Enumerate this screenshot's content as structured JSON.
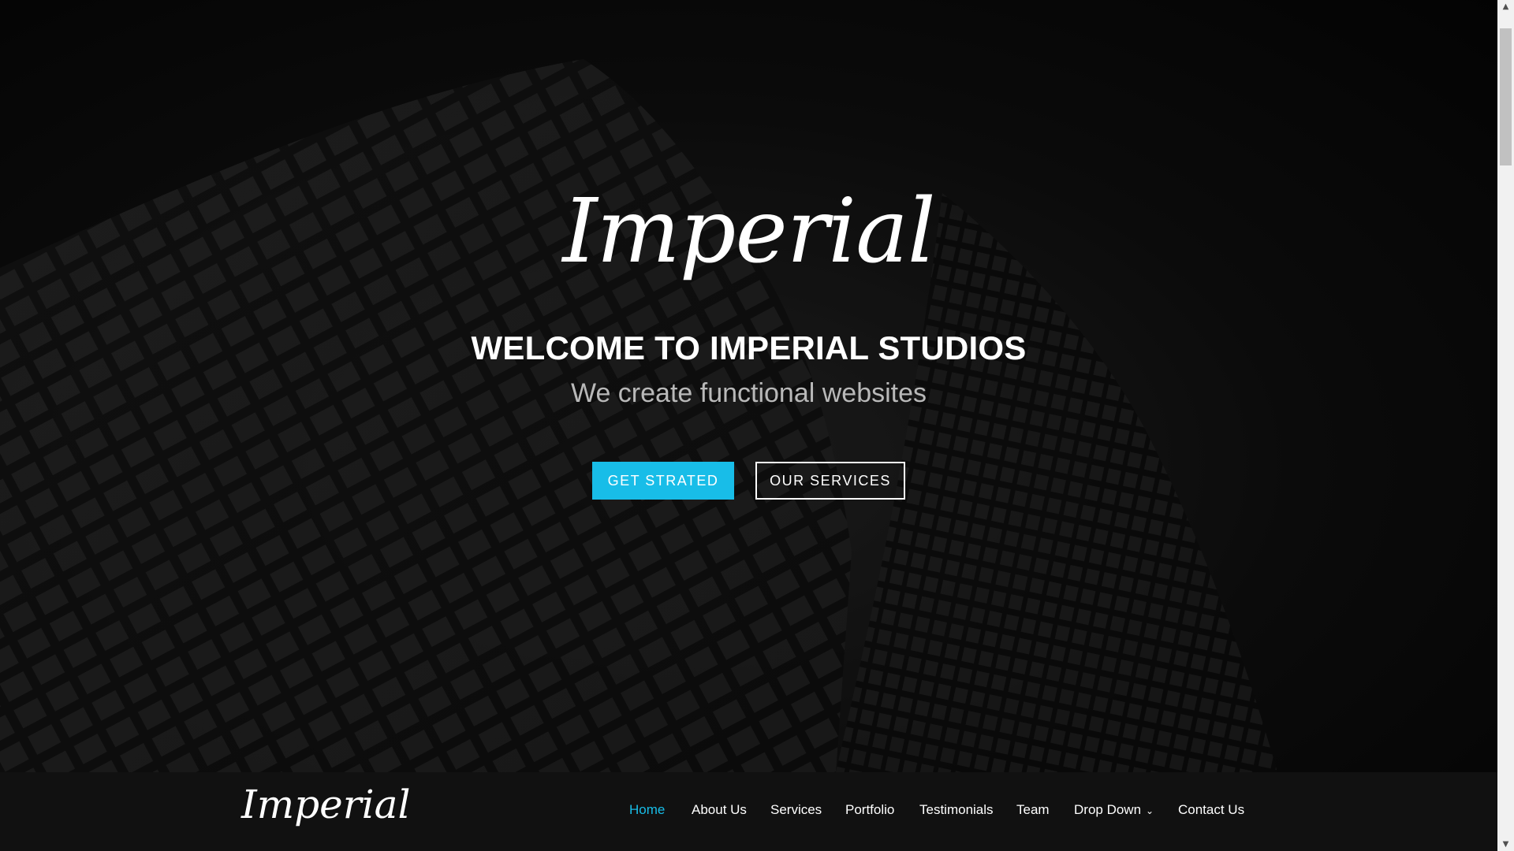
{
  "hero": {
    "logo": "Imperial",
    "title": "WELCOME TO IMPERIAL STUDIOS",
    "subtitle": "We create functional websites",
    "primary_button": "GET STRATED",
    "secondary_button": "OUR SERVICES"
  },
  "navbar": {
    "logo": "Imperial",
    "items": [
      {
        "label": "Home",
        "active": true
      },
      {
        "label": "About Us"
      },
      {
        "label": "Services"
      },
      {
        "label": "Portfolio"
      },
      {
        "label": "Testimonials"
      },
      {
        "label": "Team"
      },
      {
        "label": "Drop Down",
        "has_dropdown": true
      },
      {
        "label": "Contact Us"
      }
    ]
  },
  "colors": {
    "accent": "#18bde8",
    "nav_background": "#111111",
    "text": "#ffffff",
    "subtitle": "#b9b9b9"
  },
  "icons": {
    "dropdown": "chevron-down-icon",
    "scroll_up": "scroll-up-arrow-icon",
    "scroll_down": "scroll-down-arrow-icon"
  }
}
